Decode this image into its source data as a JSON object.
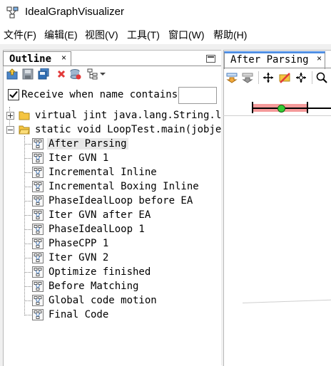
{
  "window": {
    "title": "IdealGraphVisualizer",
    "icon": "app-graph-icon"
  },
  "menu": [
    "文件(F)",
    "编辑(E)",
    "视图(V)",
    "工具(T)",
    "窗口(W)",
    "帮助(H)"
  ],
  "outline": {
    "tab_label": "Outline",
    "close_glyph": "×",
    "toolbar": [
      "import-icon",
      "save-icon",
      "save-all-icon",
      "remove-icon",
      "remove-all-icon",
      "tree-mode-icon"
    ],
    "filter": {
      "checked": true,
      "label": "Receive when name contains",
      "value": ""
    },
    "groups": [
      {
        "label": "virtual jint java.lang.String.len",
        "expanded": false
      },
      {
        "label": "static void LoopTest.main(jobject",
        "expanded": true
      }
    ],
    "graphs": [
      "After Parsing",
      "Iter GVN 1",
      "Incremental Inline",
      "Incremental Boxing Inline",
      "PhaseIdealLoop before EA",
      "Iter GVN after EA",
      "PhaseIdealLoop 1",
      "PhaseCPP 1",
      "Iter GVN 2",
      "Optimize finished",
      "Before Matching",
      "Global code motion",
      "Final Code"
    ],
    "selected": "After Parsing"
  },
  "editor": {
    "tab_label": "After Parsing",
    "close_glyph": "×",
    "toolbar": [
      "next-diagram-icon",
      "prev-diagram-icon",
      "expand-icon",
      "hide-icon",
      "show-all-icon",
      "zoom-icon"
    ]
  },
  "colors": {
    "accent_tab": "#4f8fe4",
    "slider_range": "#f59a9a",
    "slider_knob": "#33cc33"
  }
}
